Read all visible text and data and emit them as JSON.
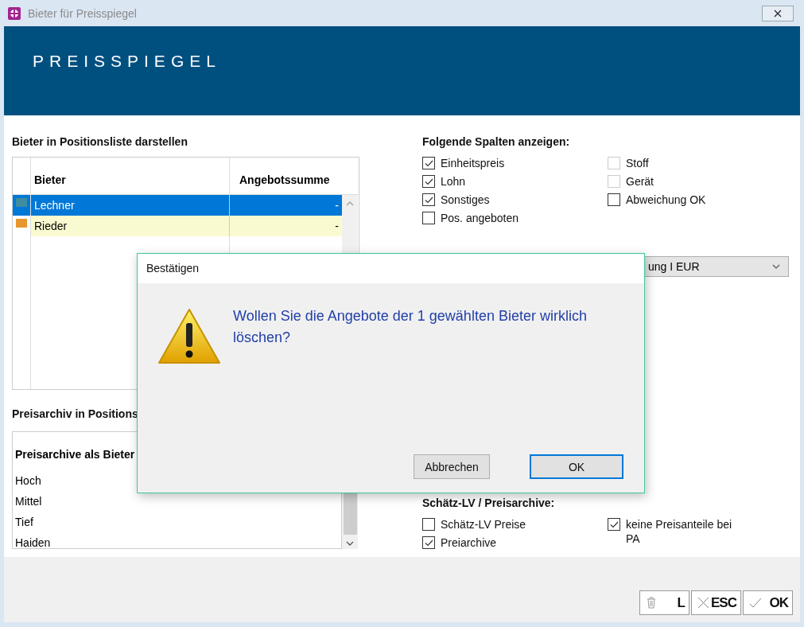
{
  "window": {
    "title": "Bieter für Preisspiegel"
  },
  "banner": {
    "title": "PREISSPIEGEL"
  },
  "bieter_section": {
    "heading": "Bieter in Positionsliste darstellen",
    "table": {
      "columns": [
        "Bieter",
        "Angebotssumme"
      ],
      "rows": [
        {
          "color": "#3d8ca0",
          "bieter": "Lechner",
          "angebotssumme": "-",
          "selected": true
        },
        {
          "color": "#e8962e",
          "bieter": "Rieder",
          "angebotssumme": "-",
          "selected": false
        }
      ]
    }
  },
  "preisarchiv_section": {
    "heading": "Preisarchiv in Positions",
    "list_heading": "Preisarchive als Bieter",
    "items": [
      "Hoch",
      "Mittel",
      "Tief",
      "Haiden"
    ]
  },
  "spalten_section": {
    "heading": "Folgende Spalten anzeigen:",
    "columns": [
      [
        {
          "label": "Einheitspreis",
          "checked": true,
          "disabled": false
        },
        {
          "label": "Lohn",
          "checked": true,
          "disabled": false
        },
        {
          "label": "Sonstiges",
          "checked": true,
          "disabled": false
        },
        {
          "label": "Pos. angeboten",
          "checked": false,
          "disabled": false
        }
      ],
      [
        {
          "label": "Stoff",
          "checked": false,
          "disabled": true
        },
        {
          "label": "Gerät",
          "checked": false,
          "disabled": true
        },
        {
          "label": "Abweichung OK",
          "checked": false,
          "disabled": false
        }
      ]
    ]
  },
  "dropdown": {
    "value": "ung I EUR"
  },
  "schaetz_section": {
    "heading": "Schätz-LV / Preisarchive:",
    "columns": [
      [
        {
          "label": "Schätz-LV Preise",
          "checked": false,
          "disabled": false
        },
        {
          "label": "Preiarchive",
          "checked": true,
          "disabled": false
        }
      ],
      [
        {
          "label": "keine Preisanteile bei PA",
          "checked": true,
          "disabled": false
        }
      ]
    ]
  },
  "footer_buttons": [
    {
      "kind": "delete",
      "label": "L"
    },
    {
      "kind": "cancel",
      "label": "ESC"
    },
    {
      "kind": "confirm",
      "label": "OK"
    }
  ],
  "dialog": {
    "title": "Bestätigen",
    "message": "Wollen Sie die Angebote der 1 gewählten Bieter wirklich löschen?",
    "buttons": [
      {
        "label": "Abbrechen",
        "default": false
      },
      {
        "label": "OK",
        "default": true
      }
    ]
  }
}
